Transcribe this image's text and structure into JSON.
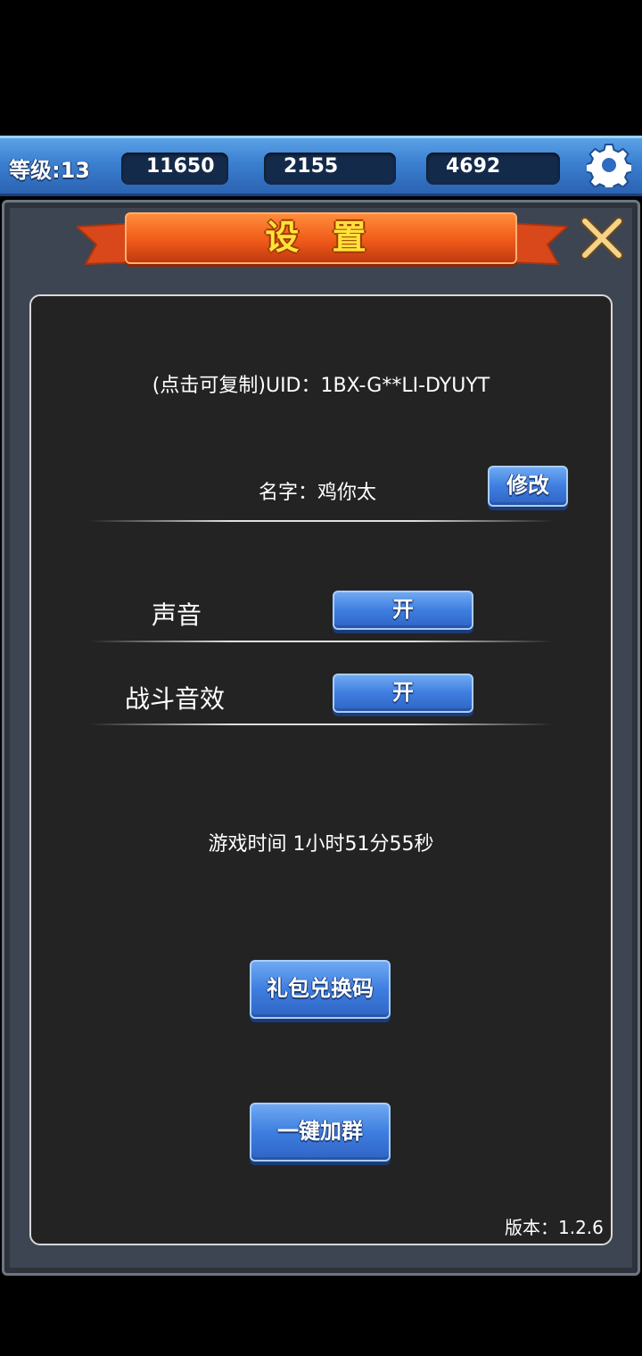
{
  "hud": {
    "level": "等级:13",
    "diamonds": "11650",
    "gold": "2155",
    "crystals": "4692"
  },
  "settings": {
    "title": "设 置",
    "uid": "(点击可复制)UID：1BX-G**LI-DYUYT",
    "name": "名字：鸡你太",
    "edit_label": "修改",
    "sound_label": "声音",
    "sound_value": "开",
    "sfx_label": "战斗音效",
    "sfx_value": "开",
    "play_time": "游戏时间 1小时51分55秒",
    "gift_code_label": "礼包兑换码",
    "join_group_label": "一键加群",
    "version": "版本：1.2.6"
  },
  "colors": {
    "hud_blue": "#3b7fd0",
    "ribbon_orange": "#f05a1a",
    "title_yellow": "#ffe23a",
    "button_blue": "#3e7ee0",
    "panel_bg": "#232323"
  },
  "icons": [
    "diamond-icon",
    "gold-coin-icon",
    "crystal-icon",
    "gear-icon",
    "close-icon"
  ]
}
